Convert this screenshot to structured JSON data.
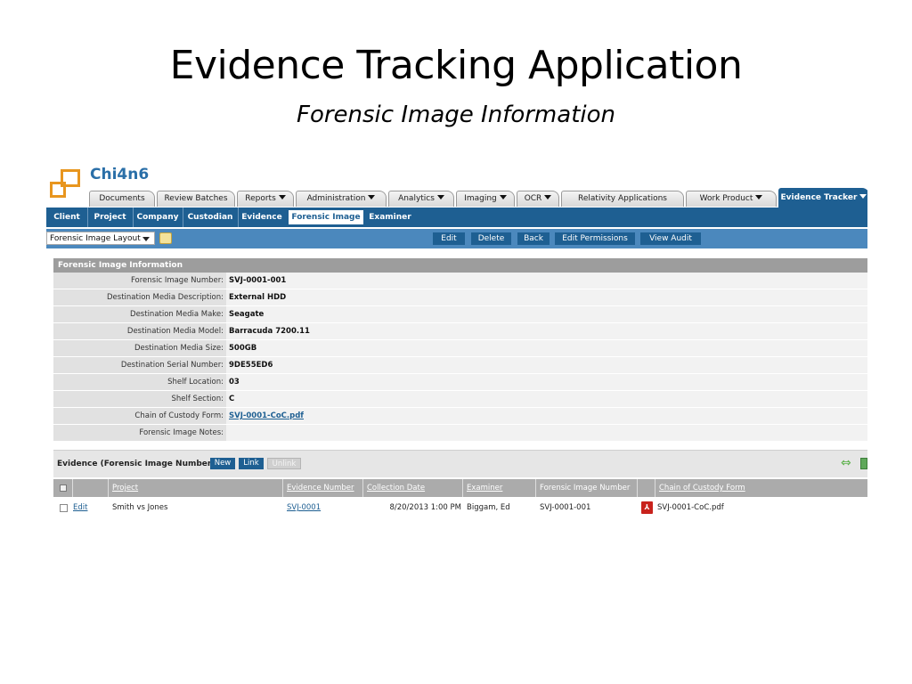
{
  "slide": {
    "title": "Evidence Tracking Application",
    "subtitle": "Forensic Image Information"
  },
  "app": {
    "brand": "Chi4n6",
    "tabs": [
      {
        "label": "Documents"
      },
      {
        "label": "Review Batches"
      },
      {
        "label": "Reports"
      },
      {
        "label": "Administration"
      },
      {
        "label": "Analytics"
      },
      {
        "label": "Imaging"
      },
      {
        "label": "OCR"
      },
      {
        "label": "Relativity Applications"
      },
      {
        "label": "Work Product"
      },
      {
        "label": "Evidence Tracker",
        "active": true
      }
    ],
    "subnav": [
      {
        "label": "Client"
      },
      {
        "label": "Project"
      },
      {
        "label": "Company"
      },
      {
        "label": "Custodian"
      },
      {
        "label": "Evidence"
      },
      {
        "label": "Forensic Image",
        "active": true
      },
      {
        "label": "Examiner"
      }
    ],
    "toolbar": {
      "layout_select": "Forensic Image Layout",
      "buttons": {
        "edit": "Edit",
        "delete": "Delete",
        "back": "Back",
        "edit_permissions": "Edit Permissions",
        "view_audit": "View Audit"
      }
    },
    "info": {
      "header": "Forensic Image Information",
      "rows": [
        {
          "label": "Forensic Image Number:",
          "value": "SVJ-0001-001"
        },
        {
          "label": "Destination Media Description:",
          "value": "External HDD"
        },
        {
          "label": "Destination Media Make:",
          "value": "Seagate"
        },
        {
          "label": "Destination Media Model:",
          "value": "Barracuda 7200.11"
        },
        {
          "label": "Destination Media Size:",
          "value": "500GB"
        },
        {
          "label": "Destination Serial Number:",
          "value": "9DE55ED6"
        },
        {
          "label": "Shelf Location:",
          "value": "03"
        },
        {
          "label": "Shelf Section:",
          "value": "C"
        },
        {
          "label": "Chain of Custody Form:",
          "value": "SVJ-0001-CoC.pdf"
        },
        {
          "label": "Forensic Image Notes:",
          "value": ""
        }
      ]
    },
    "evidence": {
      "title": "Evidence (Forensic Image Number)",
      "new_label": "New",
      "link_label": "Link",
      "unlink_label": "Unlink",
      "columns": {
        "project": "Project",
        "evidence_number": "Evidence Number",
        "collection_date": "Collection Date",
        "examiner": "Examiner",
        "forensic_image_number": "Forensic Image Number",
        "chain_of_custody_form": "Chain of Custody Form"
      },
      "rows": [
        {
          "edit": "Edit",
          "project": "Smith vs Jones",
          "evidence_number": "SVJ-0001",
          "collection_date": "8/20/2013 1:00 PM",
          "examiner": "Biggam, Ed",
          "forensic_image_number": "SVJ-0001-001",
          "chain_of_custody_form": "SVJ-0001-CoC.pdf"
        }
      ]
    }
  },
  "colors": {
    "nav_blue": "#1e5f92",
    "toolbar_blue": "#4b88bd",
    "logo_orange": "#e8961f",
    "header_gray": "#9d9d9d"
  },
  "icons": [
    "logo-icon",
    "layout-icon",
    "dropdown-caret-icon",
    "pdf-icon",
    "expand-arrows-icon",
    "select-all-checkbox"
  ]
}
